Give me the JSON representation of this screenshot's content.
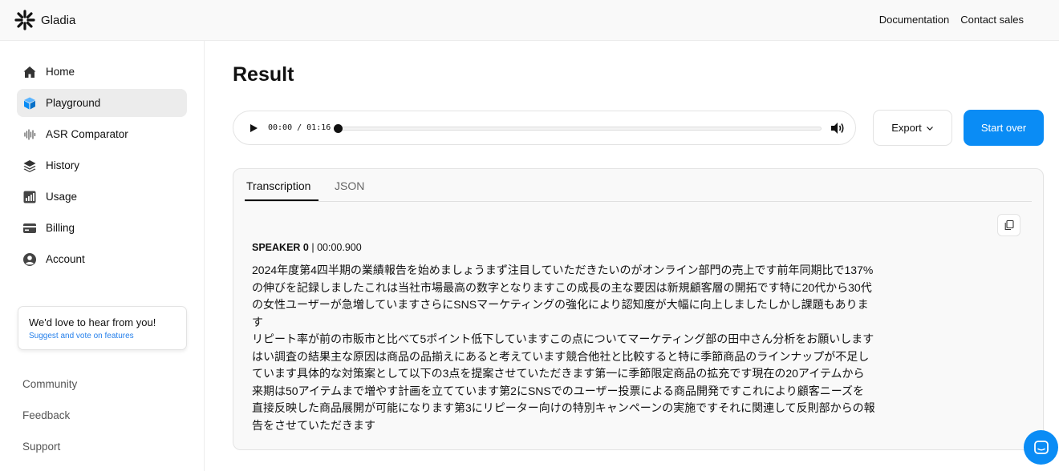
{
  "brand": {
    "name": "Gladia"
  },
  "topnav": {
    "documentation": "Documentation",
    "contact_sales": "Contact sales"
  },
  "sidebar": {
    "items": [
      {
        "label": "Home",
        "icon": "home-icon"
      },
      {
        "label": "Playground",
        "icon": "cube-icon",
        "active": true
      },
      {
        "label": "ASR Comparator",
        "icon": "waveform-icon"
      },
      {
        "label": "History",
        "icon": "layers-icon"
      },
      {
        "label": "Usage",
        "icon": "bar-chart-icon"
      },
      {
        "label": "Billing",
        "icon": "credit-card-icon"
      },
      {
        "label": "Account",
        "icon": "user-icon"
      }
    ],
    "feedback": {
      "title": "We'd love to hear from you!",
      "subtitle": "Suggest and vote on features"
    },
    "footer": [
      "Community",
      "Feedback",
      "Support"
    ]
  },
  "main": {
    "title": "Result",
    "player": {
      "time": "00:00 / 01:16",
      "progress": 0
    },
    "export_label": "Export",
    "start_over_label": "Start over",
    "tabs": [
      {
        "label": "Transcription",
        "active": true
      },
      {
        "label": "JSON",
        "active": false
      }
    ],
    "speaker": {
      "name": "SPEAKER 0",
      "timestamp": "00:00.900"
    },
    "transcript": "2024年度第4四半期の業績報告を始めましょうまず注目していただきたいのがオンライン部門の売上です前年同期比で137%\nの伸びを記録しましたこれは当社市場最高の数字となりますこの成長の主な要因は新規顧客層の開拓です特に20代から30代\nの女性ユーザーが急増していますさらにSNSマーケティングの強化により認知度が大幅に向上しましたしかし課題もありま\nす\nリピート率が前の市販市と比べて5ポイント低下していますこの点についてマーケティング部の田中さん分析をお願いします\nはい調査の結果主な原因は商品の品揃えにあると考えています競合他社と比較すると特に季節商品のラインナップが不足し\nています具体的な対策案として以下の3点を提案させていただきます第一に季節限定商品の拡充です現在の20アイテムから\n来期は50アイテムまで増やす計画を立てています第2にSNSでのユーザー投票による商品開発ですこれにより顧客ニーズを\n直接反映した商品展開が可能になります第3にリピーター向けの特別キャンペーンの実施ですそれに関連して反則部からの報\n告をさせていただきます"
  },
  "colors": {
    "accent": "#0a8cf5",
    "active_nav": "#ececec",
    "link": "#2680eb"
  }
}
